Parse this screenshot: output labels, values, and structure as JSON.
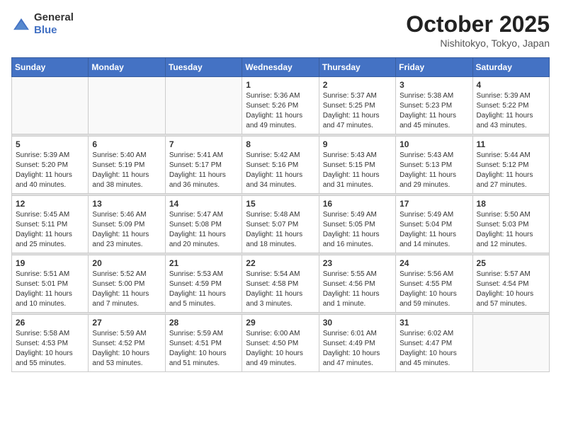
{
  "logo": {
    "general": "General",
    "blue": "Blue"
  },
  "header": {
    "month": "October 2025",
    "location": "Nishitokyo, Tokyo, Japan"
  },
  "weekdays": [
    "Sunday",
    "Monday",
    "Tuesday",
    "Wednesday",
    "Thursday",
    "Friday",
    "Saturday"
  ],
  "weeks": [
    [
      {
        "day": "",
        "info": ""
      },
      {
        "day": "",
        "info": ""
      },
      {
        "day": "",
        "info": ""
      },
      {
        "day": "1",
        "info": "Sunrise: 5:36 AM\nSunset: 5:26 PM\nDaylight: 11 hours and 49 minutes."
      },
      {
        "day": "2",
        "info": "Sunrise: 5:37 AM\nSunset: 5:25 PM\nDaylight: 11 hours and 47 minutes."
      },
      {
        "day": "3",
        "info": "Sunrise: 5:38 AM\nSunset: 5:23 PM\nDaylight: 11 hours and 45 minutes."
      },
      {
        "day": "4",
        "info": "Sunrise: 5:39 AM\nSunset: 5:22 PM\nDaylight: 11 hours and 43 minutes."
      }
    ],
    [
      {
        "day": "5",
        "info": "Sunrise: 5:39 AM\nSunset: 5:20 PM\nDaylight: 11 hours and 40 minutes."
      },
      {
        "day": "6",
        "info": "Sunrise: 5:40 AM\nSunset: 5:19 PM\nDaylight: 11 hours and 38 minutes."
      },
      {
        "day": "7",
        "info": "Sunrise: 5:41 AM\nSunset: 5:17 PM\nDaylight: 11 hours and 36 minutes."
      },
      {
        "day": "8",
        "info": "Sunrise: 5:42 AM\nSunset: 5:16 PM\nDaylight: 11 hours and 34 minutes."
      },
      {
        "day": "9",
        "info": "Sunrise: 5:43 AM\nSunset: 5:15 PM\nDaylight: 11 hours and 31 minutes."
      },
      {
        "day": "10",
        "info": "Sunrise: 5:43 AM\nSunset: 5:13 PM\nDaylight: 11 hours and 29 minutes."
      },
      {
        "day": "11",
        "info": "Sunrise: 5:44 AM\nSunset: 5:12 PM\nDaylight: 11 hours and 27 minutes."
      }
    ],
    [
      {
        "day": "12",
        "info": "Sunrise: 5:45 AM\nSunset: 5:11 PM\nDaylight: 11 hours and 25 minutes."
      },
      {
        "day": "13",
        "info": "Sunrise: 5:46 AM\nSunset: 5:09 PM\nDaylight: 11 hours and 23 minutes."
      },
      {
        "day": "14",
        "info": "Sunrise: 5:47 AM\nSunset: 5:08 PM\nDaylight: 11 hours and 20 minutes."
      },
      {
        "day": "15",
        "info": "Sunrise: 5:48 AM\nSunset: 5:07 PM\nDaylight: 11 hours and 18 minutes."
      },
      {
        "day": "16",
        "info": "Sunrise: 5:49 AM\nSunset: 5:05 PM\nDaylight: 11 hours and 16 minutes."
      },
      {
        "day": "17",
        "info": "Sunrise: 5:49 AM\nSunset: 5:04 PM\nDaylight: 11 hours and 14 minutes."
      },
      {
        "day": "18",
        "info": "Sunrise: 5:50 AM\nSunset: 5:03 PM\nDaylight: 11 hours and 12 minutes."
      }
    ],
    [
      {
        "day": "19",
        "info": "Sunrise: 5:51 AM\nSunset: 5:01 PM\nDaylight: 11 hours and 10 minutes."
      },
      {
        "day": "20",
        "info": "Sunrise: 5:52 AM\nSunset: 5:00 PM\nDaylight: 11 hours and 7 minutes."
      },
      {
        "day": "21",
        "info": "Sunrise: 5:53 AM\nSunset: 4:59 PM\nDaylight: 11 hours and 5 minutes."
      },
      {
        "day": "22",
        "info": "Sunrise: 5:54 AM\nSunset: 4:58 PM\nDaylight: 11 hours and 3 minutes."
      },
      {
        "day": "23",
        "info": "Sunrise: 5:55 AM\nSunset: 4:56 PM\nDaylight: 11 hours and 1 minute."
      },
      {
        "day": "24",
        "info": "Sunrise: 5:56 AM\nSunset: 4:55 PM\nDaylight: 10 hours and 59 minutes."
      },
      {
        "day": "25",
        "info": "Sunrise: 5:57 AM\nSunset: 4:54 PM\nDaylight: 10 hours and 57 minutes."
      }
    ],
    [
      {
        "day": "26",
        "info": "Sunrise: 5:58 AM\nSunset: 4:53 PM\nDaylight: 10 hours and 55 minutes."
      },
      {
        "day": "27",
        "info": "Sunrise: 5:59 AM\nSunset: 4:52 PM\nDaylight: 10 hours and 53 minutes."
      },
      {
        "day": "28",
        "info": "Sunrise: 5:59 AM\nSunset: 4:51 PM\nDaylight: 10 hours and 51 minutes."
      },
      {
        "day": "29",
        "info": "Sunrise: 6:00 AM\nSunset: 4:50 PM\nDaylight: 10 hours and 49 minutes."
      },
      {
        "day": "30",
        "info": "Sunrise: 6:01 AM\nSunset: 4:49 PM\nDaylight: 10 hours and 47 minutes."
      },
      {
        "day": "31",
        "info": "Sunrise: 6:02 AM\nSunset: 4:47 PM\nDaylight: 10 hours and 45 minutes."
      },
      {
        "day": "",
        "info": ""
      }
    ]
  ]
}
